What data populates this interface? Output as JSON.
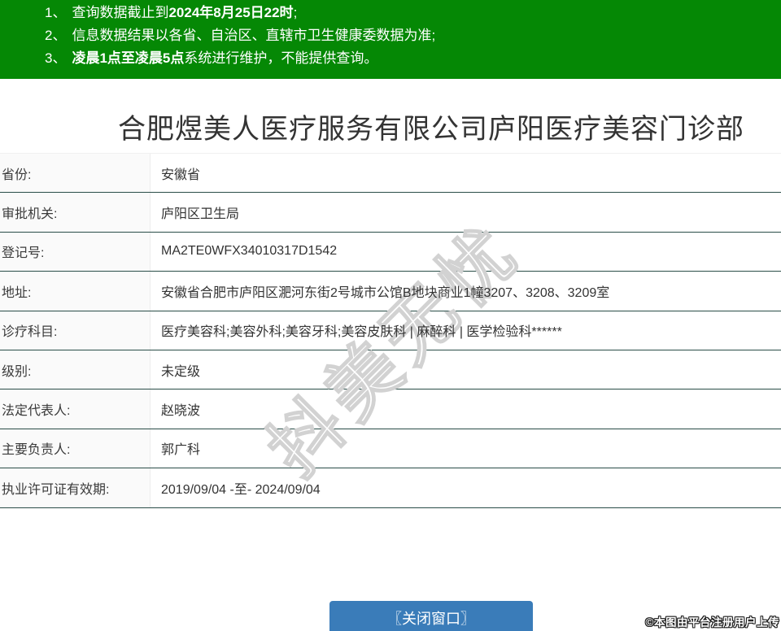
{
  "colors": {
    "banner-green": "#058805",
    "divider-teal": "#2a4d48",
    "button-blue": "#3a7cb9",
    "text-dark": "#333333",
    "label-bg": "#fafafa"
  },
  "notice": {
    "lines": [
      {
        "num": "1、",
        "pre": "查询数据截止到",
        "bold": "2024年8月25日22时",
        "post": ";"
      },
      {
        "num": "2、",
        "pre": "信息数据结果以各省、自治区、直辖市卫生健康委数据为准;",
        "bold": "",
        "post": ""
      },
      {
        "num": "3、",
        "pre": "",
        "bold": "凌晨1点至凌晨5点",
        "post": "系统进行维护，不能提供查询。"
      }
    ]
  },
  "header": {
    "title": "合肥煜美人医疗服务有限公司庐阳医疗美容门诊部"
  },
  "table": {
    "rows": [
      {
        "label": "省份:",
        "value": "安徽省"
      },
      {
        "label": "审批机关:",
        "value": "庐阳区卫生局"
      },
      {
        "label": "登记号:",
        "value": "MA2TE0WFX34010317D1542"
      },
      {
        "label": "地址:",
        "value": "安徽省合肥市庐阳区淝河东街2号城市公馆B地块商业1幢3207、3208、3209室"
      },
      {
        "label": "诊疗科目:",
        "value": "医疗美容科;美容外科;美容牙科;美容皮肤科 | 麻醉科 | 医学检验科******"
      },
      {
        "label": "级别:",
        "value": "未定级"
      },
      {
        "label": "法定代表人:",
        "value": "赵晓波"
      },
      {
        "label": "主要负责人:",
        "value": "郭广科"
      },
      {
        "label": "执业许可证有效期:",
        "value": "2019/09/04 -至- 2024/09/04"
      }
    ]
  },
  "footer": {
    "close_button_label": "〖关闭窗口〗"
  },
  "watermark": {
    "diagonal_text": "抖美无忧",
    "copyright_text": "©本图由平台注册用户上传"
  }
}
